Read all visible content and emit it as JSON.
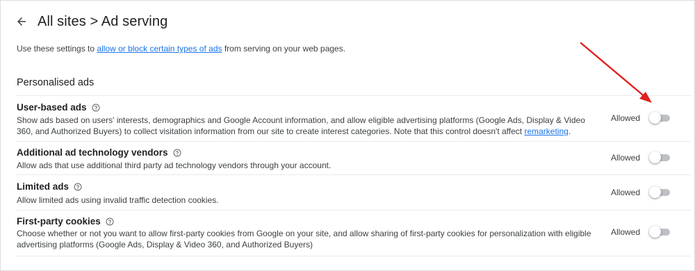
{
  "header": {
    "back_icon": "arrow-left-icon",
    "title": "All sites > Ad serving"
  },
  "intro": {
    "prefix": "Use these settings to ",
    "link": "allow or block certain types of ads",
    "suffix": " from serving on your web pages."
  },
  "section": {
    "title": "Personalised ads"
  },
  "settings": [
    {
      "name": "User-based ads",
      "help_icon": "help-circle-icon",
      "desc_prefix": "Show ads based on users' interests, demographics and Google Account information, and allow eligible advertising platforms (Google Ads, Display & Video 360, and Authorized Buyers) to collect visitation information from our site to create interest categories. Note that this control doesn't affect ",
      "desc_link": "remarketing",
      "desc_suffix": ".",
      "status": "Allowed",
      "toggle_on": false
    },
    {
      "name": "Additional ad technology vendors",
      "help_icon": "help-circle-icon",
      "desc_prefix": "Allow ads that use additional third party ad technology vendors through your account.",
      "desc_link": "",
      "desc_suffix": "",
      "status": "Allowed",
      "toggle_on": false
    },
    {
      "name": "Limited ads",
      "help_icon": "help-circle-icon",
      "desc_prefix": "Allow limited ads using invalid traffic detection cookies.",
      "desc_link": "",
      "desc_suffix": "",
      "status": "Allowed",
      "toggle_on": false
    },
    {
      "name": "First-party cookies",
      "help_icon": "help-circle-icon",
      "desc_prefix": "Choose whether or not you want to allow first-party cookies from Google on your site, and allow sharing of first-party cookies for personalization with eligible advertising platforms (Google Ads, Display & Video 360, and Authorized Buyers)",
      "desc_link": "",
      "desc_suffix": "",
      "status": "Allowed",
      "toggle_on": false
    }
  ],
  "annotation": {
    "arrow_icon": "red-annotation-arrow",
    "color": "#e02020"
  },
  "colors": {
    "link": "#1a73e8",
    "toggle_track_off": "#bdc1c6"
  }
}
